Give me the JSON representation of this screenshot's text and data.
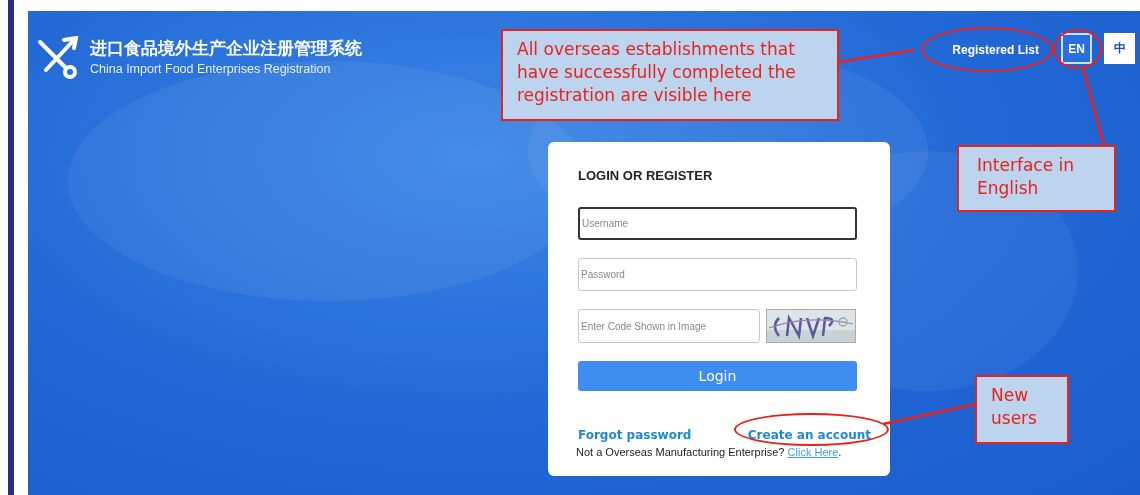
{
  "header": {
    "title": "进口食品境外生产企业注册管理系统",
    "subtitle": "China Import Food Enterprises Registration",
    "registered_list": {
      "label": "Registered List",
      "circled": true
    },
    "languages": [
      {
        "label": "EN",
        "selected": true,
        "circled": true
      },
      {
        "label": "中",
        "selected": false,
        "circled": false
      }
    ]
  },
  "login_card": {
    "title": "LOGIN OR REGISTER",
    "fields": [
      {
        "placeholder": "Username",
        "focused": true
      },
      {
        "placeholder": "Password",
        "focused": false
      }
    ],
    "captcha": {
      "placeholder": "Enter Code Shown in Image"
    },
    "button": "Login",
    "links": [
      {
        "label": "Forgot password",
        "circled": false
      },
      {
        "label": "Create an account",
        "circled": true
      }
    ],
    "note": {
      "text": "Not a Overseas Manufacturing Enterprise? ",
      "link": "Click Here",
      "after": "."
    }
  },
  "callouts": [
    {
      "text": "All overseas establishments that have successfully completed the registration are visible here"
    },
    {
      "text": "Interface in English"
    },
    {
      "text": "New users"
    }
  ]
}
